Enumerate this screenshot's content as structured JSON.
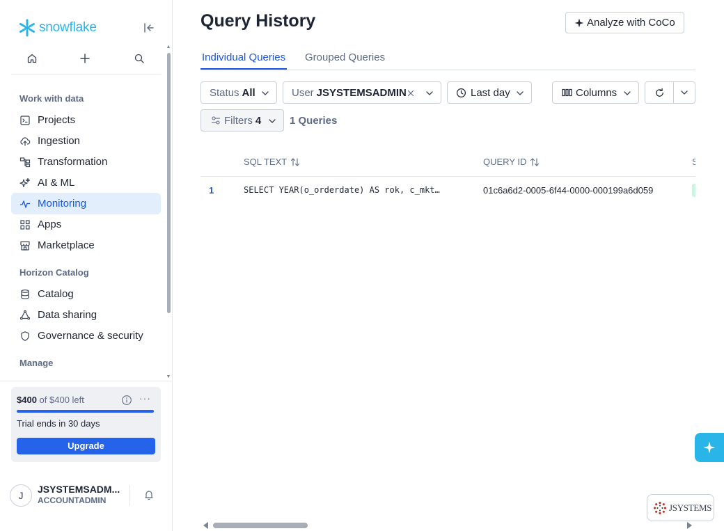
{
  "app": {
    "logo_text": "snowflake",
    "accent_color": "#29b5e8",
    "primary_color": "#2563eb"
  },
  "sidebar": {
    "top_icons": [
      "home-icon",
      "plus-icon",
      "search-icon"
    ],
    "sections": [
      {
        "title": "Work with data",
        "items": [
          {
            "label": "Projects",
            "icon": "terminal-icon"
          },
          {
            "label": "Ingestion",
            "icon": "cloud-upload-icon"
          },
          {
            "label": "Transformation",
            "icon": "flow-icon"
          },
          {
            "label": "AI & ML",
            "icon": "sparkles-icon"
          },
          {
            "label": "Monitoring",
            "icon": "activity-icon",
            "active": true
          },
          {
            "label": "Apps",
            "icon": "grid-icon"
          },
          {
            "label": "Marketplace",
            "icon": "store-icon"
          }
        ]
      },
      {
        "title": "Horizon Catalog",
        "items": [
          {
            "label": "Catalog",
            "icon": "database-icon"
          },
          {
            "label": "Data sharing",
            "icon": "share-icon"
          },
          {
            "label": "Governance & security",
            "icon": "shield-icon"
          }
        ]
      },
      {
        "title": "Manage",
        "items": []
      }
    ]
  },
  "credits": {
    "amount": "$400",
    "of_text": "of $400 left",
    "remaining_fraction": 1.0,
    "trial_text": "Trial ends in 30 days",
    "upgrade_label": "Upgrade"
  },
  "user": {
    "initial": "J",
    "name": "JSYSTEMSADM...",
    "role": "ACCOUNTADMIN"
  },
  "page": {
    "title": "Query History",
    "analyze_label": "Analyze with CoCo",
    "tabs": [
      {
        "label": "Individual Queries",
        "active": true
      },
      {
        "label": "Grouped Queries",
        "active": false
      }
    ]
  },
  "filters": {
    "status_label": "Status",
    "status_value": "All",
    "user_label": "User",
    "user_value": "JSYSTEMSADMIN",
    "time_value": "Last day",
    "columns_label": "Columns",
    "filters_label": "Filters",
    "filters_count": "4",
    "query_count": "1 Queries"
  },
  "table": {
    "columns": [
      "SQL TEXT",
      "QUERY ID",
      "S"
    ],
    "rows": [
      {
        "num": "1",
        "sql": "SELECT YEAR(o_orderdate) AS rok, c_mkt…",
        "query_id": "01c6a6d2-0005-6f44-0000-000199a6d059"
      }
    ]
  },
  "badge": {
    "text": "JSYSTEMS"
  }
}
